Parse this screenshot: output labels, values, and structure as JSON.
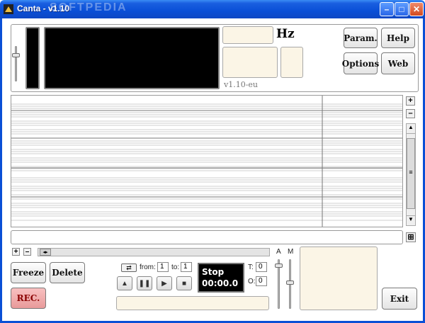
{
  "window": {
    "title": "Canta - v1.10",
    "watermark": "SOFTPEDIA"
  },
  "header": {
    "hz_label": "Hz",
    "version_label": "v1.10-eu"
  },
  "buttons": {
    "param": "Param.",
    "help": "Help",
    "options": "Options",
    "web": "Web",
    "freeze": "Freeze",
    "delete": "Delete",
    "rec": "REC.",
    "exit": "Exit"
  },
  "loop": {
    "from_label": "from:",
    "from_value": "1",
    "to_label": "to:",
    "to_value": "1"
  },
  "transport": {
    "status": "Stop",
    "time": "00:00.0"
  },
  "counters": {
    "t_label": "T:",
    "t_value": "0",
    "o_label": "O:",
    "o_value": "0"
  },
  "sliders": {
    "a_label": "A",
    "m_label": "M"
  },
  "colors": {
    "titlebar": "#0a4fd6",
    "cream": "#fbf5e6",
    "rec": "#e89a9a"
  }
}
